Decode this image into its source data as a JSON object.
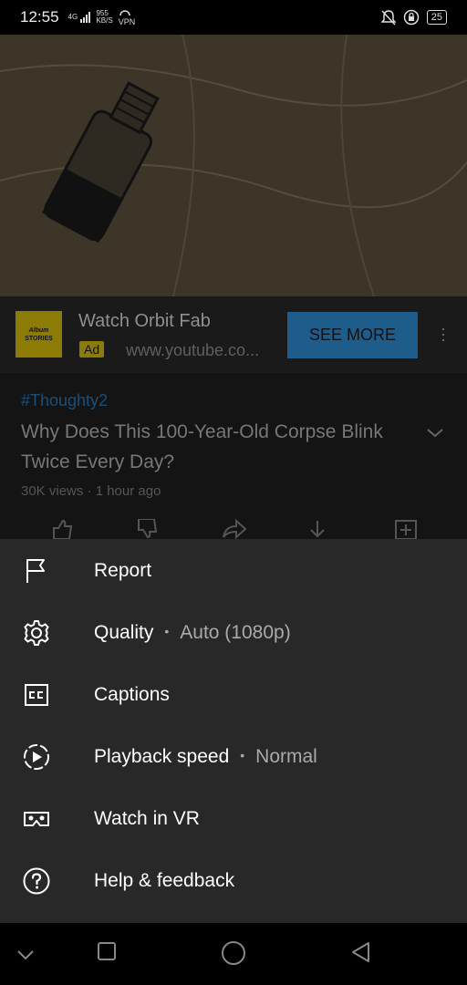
{
  "status_bar": {
    "time": "12:55",
    "network_top": "4G",
    "network_speed": "955",
    "network_unit": "KB/S",
    "vpn": "VPN",
    "battery": "25"
  },
  "ad": {
    "logo_line1": "Album",
    "logo_line2": "STORIES",
    "title": "Watch Orbit Fab",
    "badge": "Ad",
    "url": "www.youtube.co...",
    "cta": "SEE MORE"
  },
  "video": {
    "hashtag": "#Thoughty2",
    "title": "Why Does This 100-Year-Old Corpse Blink Twice Every Day?",
    "meta": "30K views · 1 hour ago"
  },
  "menu": {
    "items": [
      {
        "label": "Report",
        "icon": "flag-icon"
      },
      {
        "label": "Quality",
        "value": "Auto (1080p)",
        "icon": "gear-icon"
      },
      {
        "label": "Captions",
        "icon": "captions-icon"
      },
      {
        "label": "Playback speed",
        "value": "Normal",
        "icon": "playback-speed-icon"
      },
      {
        "label": "Watch in VR",
        "icon": "vr-icon"
      },
      {
        "label": "Help & feedback",
        "icon": "help-icon"
      }
    ],
    "separator": "•"
  },
  "colors": {
    "sheet_bg": "#282828",
    "accent": "#1e5c8c",
    "ad_badge": "#8a7c0a"
  }
}
